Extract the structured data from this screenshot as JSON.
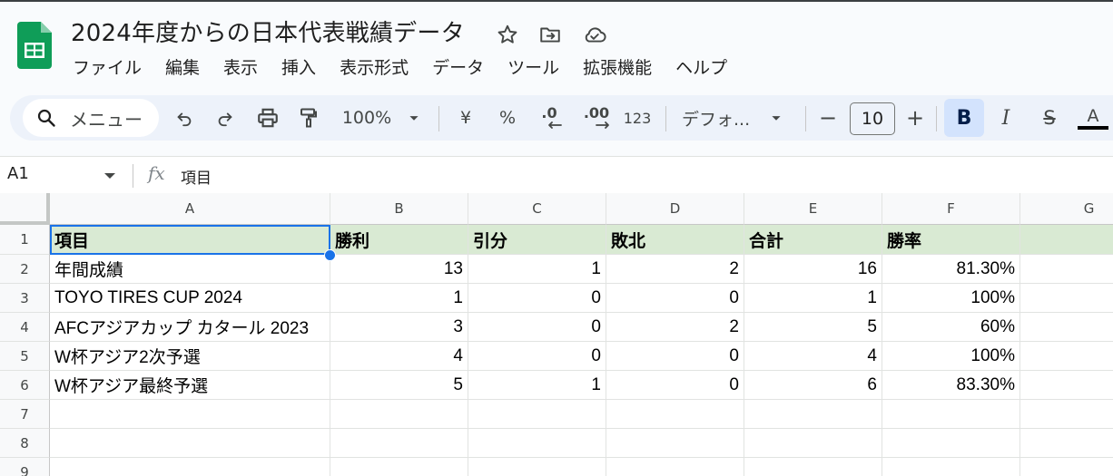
{
  "app": {
    "title": "2024年度からの日本代表戦績データ",
    "icons": [
      "star-icon",
      "move-to-folder-icon",
      "cloud-saved-icon"
    ],
    "brand_color": "#0f9d58"
  },
  "menu": [
    "ファイル",
    "編集",
    "表示",
    "挿入",
    "表示形式",
    "データ",
    "ツール",
    "拡張機能",
    "ヘルプ"
  ],
  "toolbar": {
    "search_label": "メニュー",
    "zoom": "100%",
    "currency": "¥",
    "percent": "%",
    "decrease_decimal": ".0",
    "increase_decimal": ".00",
    "more_formats": "123",
    "font": "デフォ...",
    "font_size": "10",
    "minus": "−",
    "plus": "+",
    "bold": "B",
    "italic": "I",
    "strike": "S",
    "text_color": "A"
  },
  "formula_bar": {
    "cell_ref": "A1",
    "fx": "fx",
    "content": "項目"
  },
  "columns": [
    "A",
    "B",
    "C",
    "D",
    "E",
    "F",
    "G"
  ],
  "rows": [
    "1",
    "2",
    "3",
    "4",
    "5",
    "6",
    "7",
    "8",
    "9"
  ],
  "sheet": {
    "header": [
      "項目",
      "勝利",
      "引分",
      "敗北",
      "合計",
      "勝率"
    ],
    "data": [
      [
        "年間成績",
        "13",
        "1",
        "2",
        "16",
        "81.30%"
      ],
      [
        "TOYO TIRES CUP 2024",
        "1",
        "0",
        "0",
        "1",
        "100%"
      ],
      [
        "AFCアジアカップ カタール 2023",
        "3",
        "0",
        "2",
        "5",
        "60%"
      ],
      [
        "W杯アジア2次予選",
        "4",
        "0",
        "0",
        "4",
        "100%"
      ],
      [
        "W杯アジア最終予選",
        "5",
        "1",
        "0",
        "6",
        "83.30%"
      ]
    ]
  }
}
